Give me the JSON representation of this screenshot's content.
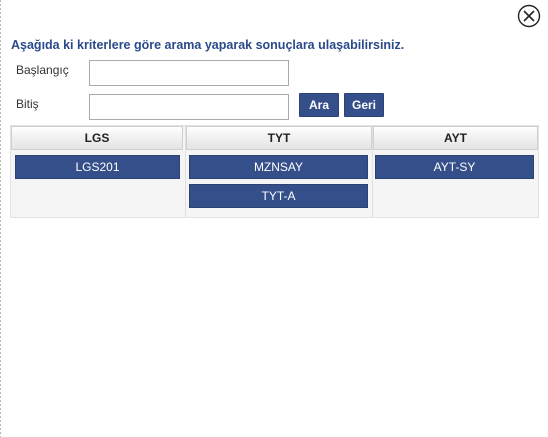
{
  "dialog": {
    "close_icon": "close-circle-icon",
    "instruction": "Aşağıda ki kriterlere göre arama yaparak sonuçlara ulaşabilirsiniz."
  },
  "form": {
    "start_label": "Başlangıç",
    "start_value": "",
    "end_label": "Bitiş",
    "end_value": "",
    "search_button": "Ara",
    "back_button": "Geri"
  },
  "results": {
    "columns": [
      {
        "header": "LGS",
        "items": [
          "LGS201"
        ]
      },
      {
        "header": "TYT",
        "items": [
          "MZNSAY",
          "TYT-A"
        ]
      },
      {
        "header": "AYT",
        "items": [
          "AYT-SY"
        ]
      }
    ]
  },
  "colors": {
    "accent": "#354f8a",
    "instruction_text": "#2b4a8a"
  }
}
